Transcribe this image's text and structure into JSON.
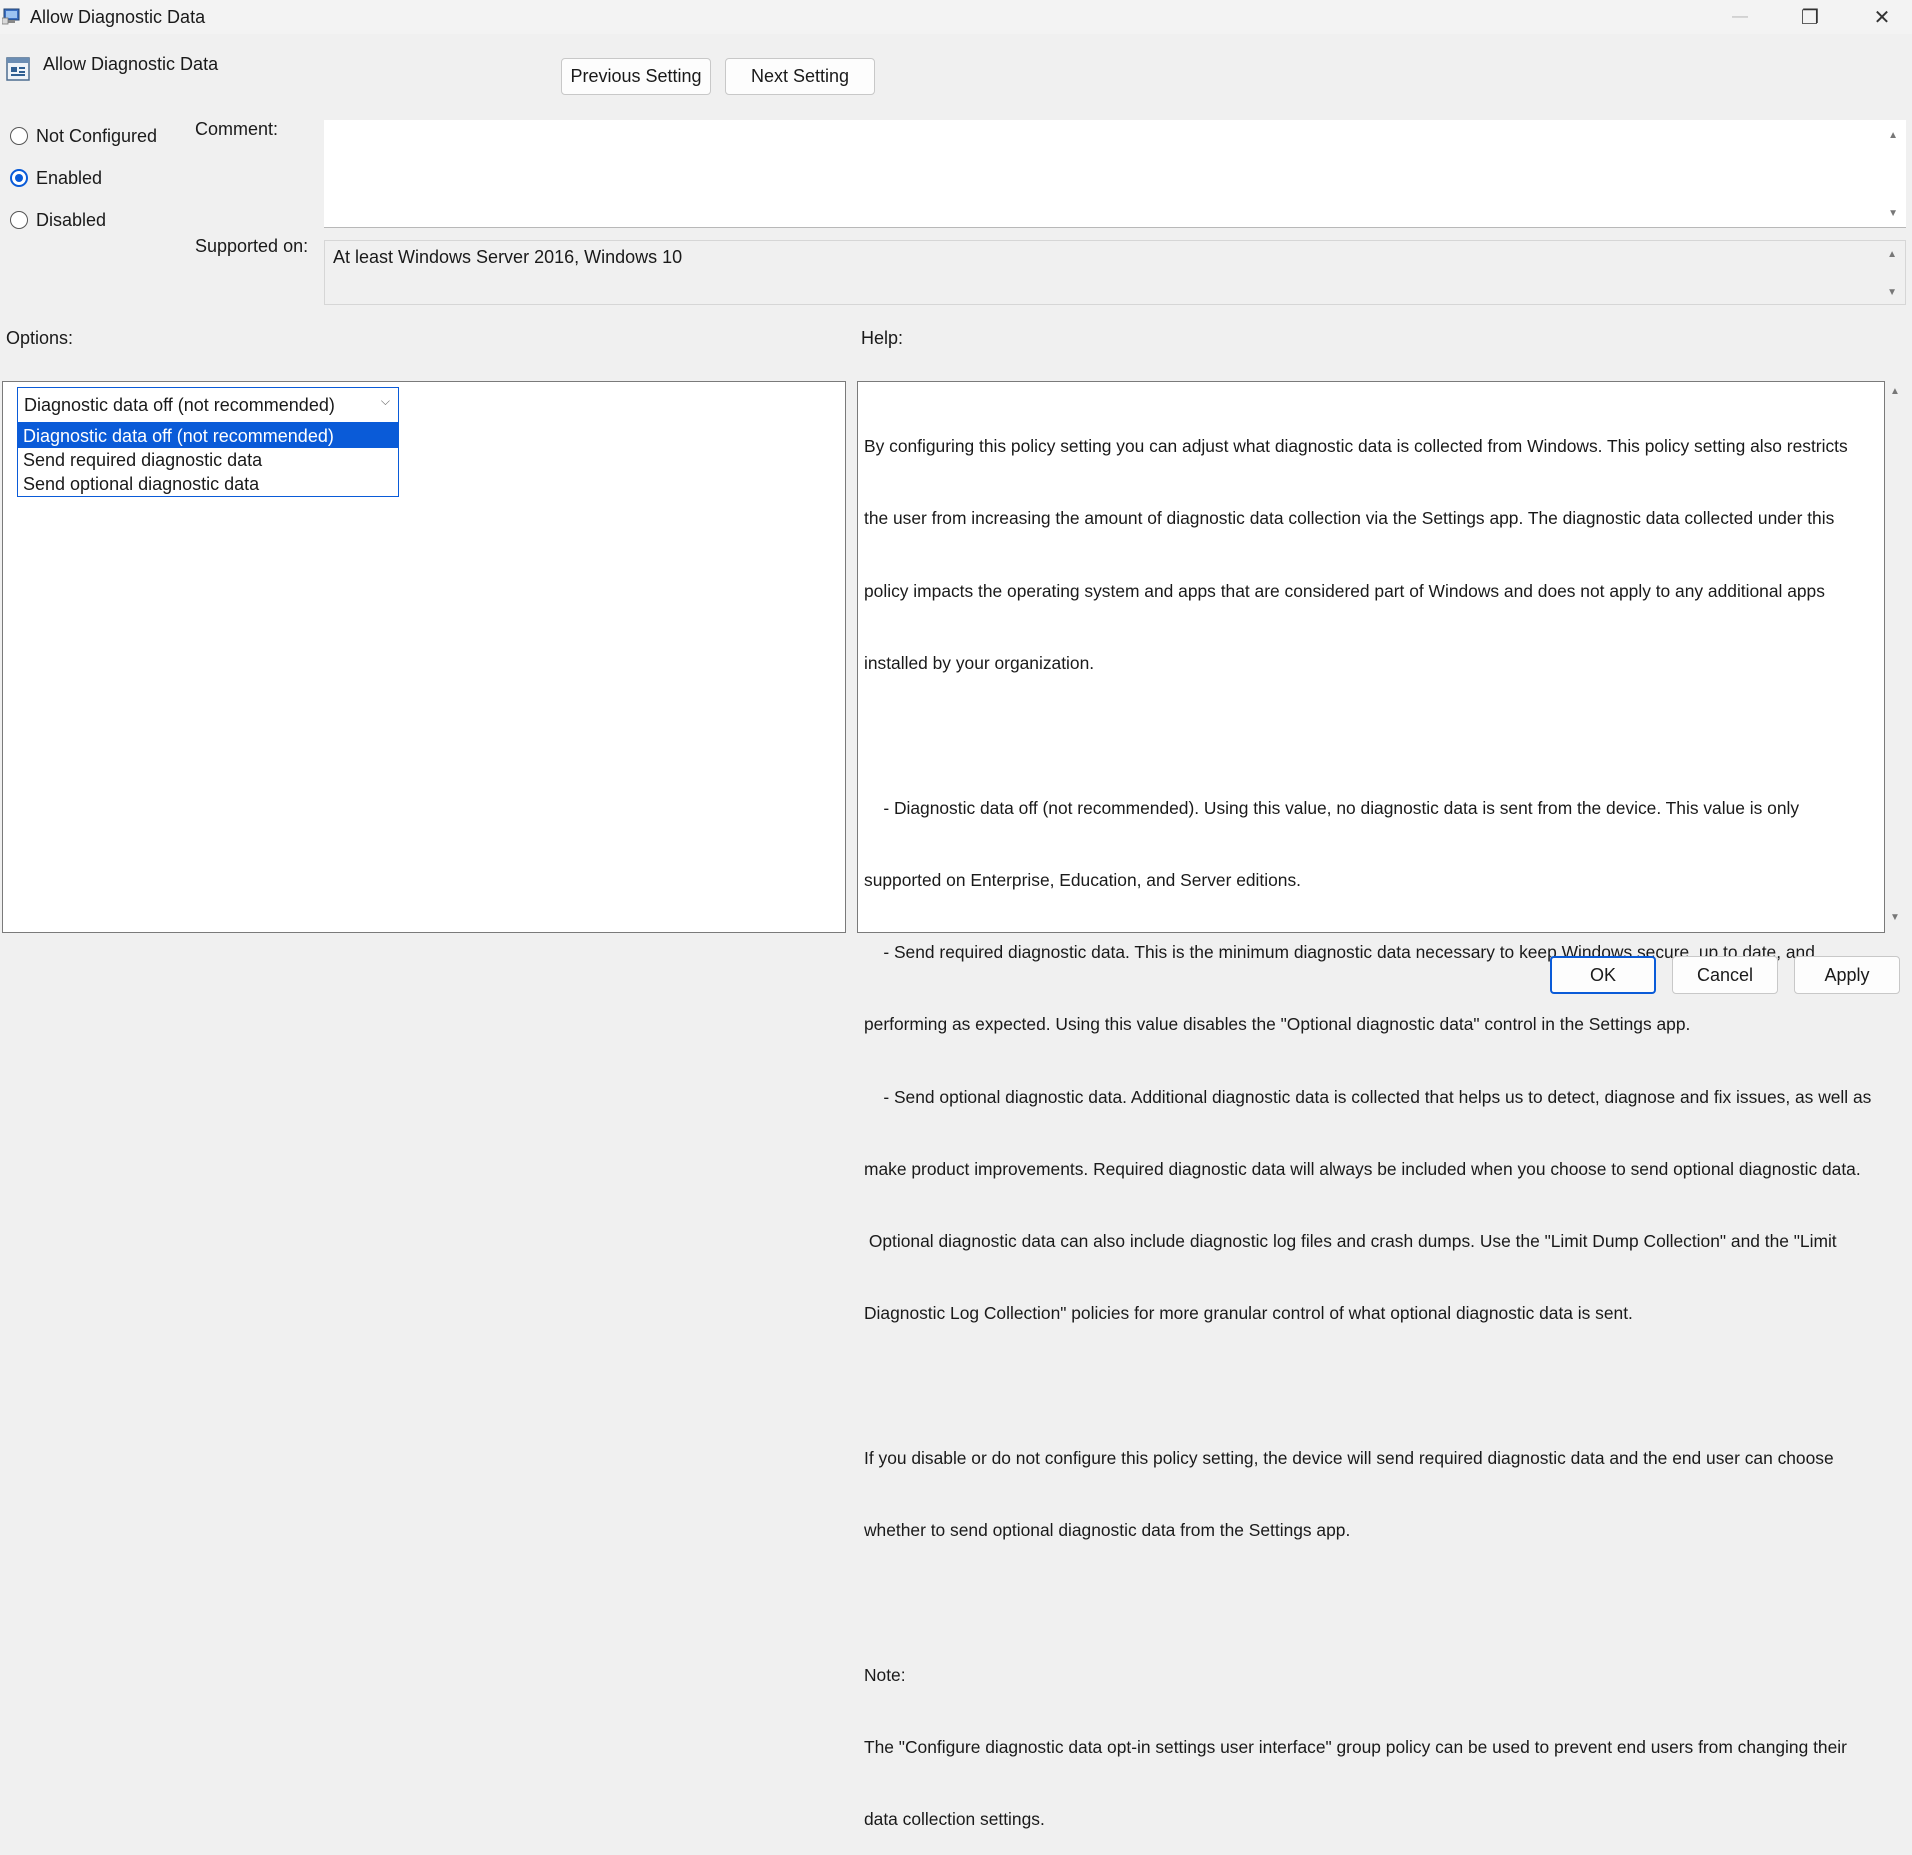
{
  "window": {
    "title": "Allow Diagnostic Data",
    "controls": {
      "minimize": "—",
      "restore": "❐",
      "close": "✕"
    }
  },
  "header": {
    "policy_name": "Allow Diagnostic Data",
    "previous_label": "Previous Setting",
    "next_label": "Next Setting"
  },
  "state": {
    "options": [
      {
        "label": "Not Configured",
        "checked": false
      },
      {
        "label": "Enabled",
        "checked": true
      },
      {
        "label": "Disabled",
        "checked": false
      }
    ]
  },
  "comment": {
    "label": "Comment:",
    "value": ""
  },
  "supported": {
    "label": "Supported on:",
    "value": "At least Windows Server 2016, Windows 10"
  },
  "options_section": {
    "label": "Options:",
    "selected": "Diagnostic data off (not recommended)",
    "items": [
      "Diagnostic data off (not recommended)",
      "Send required diagnostic data",
      "Send optional diagnostic data"
    ]
  },
  "help_section": {
    "label": "Help:",
    "lines": [
      "By configuring this policy setting you can adjust what diagnostic data is collected from Windows. This policy setting also restricts",
      "the user from increasing the amount of diagnostic data collection via the Settings app. The diagnostic data collected under this",
      "policy impacts the operating system and apps that are considered part of Windows and does not apply to any additional apps",
      "installed by your organization.",
      "",
      "    - Diagnostic data off (not recommended). Using this value, no diagnostic data is sent from the device. This value is only",
      "supported on Enterprise, Education, and Server editions.",
      "    - Send required diagnostic data. This is the minimum diagnostic data necessary to keep Windows secure, up to date, and",
      "performing as expected. Using this value disables the \"Optional diagnostic data\" control in the Settings app.",
      "    - Send optional diagnostic data. Additional diagnostic data is collected that helps us to detect, diagnose and fix issues, as well as",
      "make product improvements. Required diagnostic data will always be included when you choose to send optional diagnostic data.",
      " Optional diagnostic data can also include diagnostic log files and crash dumps. Use the \"Limit Dump Collection\" and the \"Limit",
      "Diagnostic Log Collection\" policies for more granular control of what optional diagnostic data is sent.",
      "",
      "If you disable or do not configure this policy setting, the device will send required diagnostic data and the end user can choose",
      "whether to send optional diagnostic data from the Settings app.",
      "",
      "Note:",
      "The \"Configure diagnostic data opt-in settings user interface\" group policy can be used to prevent end users from changing their",
      "data collection settings."
    ]
  },
  "footer": {
    "ok_label": "OK",
    "cancel_label": "Cancel",
    "apply_label": "Apply"
  },
  "colors": {
    "accent": "#0a5bd8",
    "background": "#f0f0f0"
  }
}
